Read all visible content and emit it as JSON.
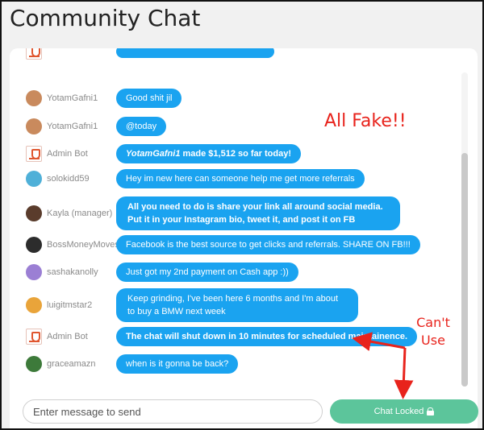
{
  "header": {
    "title": "Community Chat"
  },
  "colors": {
    "bubble": "#1aa3f0",
    "locked_button": "#5cc59b",
    "annotation": "#e8231c"
  },
  "messages": [
    {
      "user": "Admin Bot",
      "text": "YotamGafni1 made $1,512 so far today!",
      "avatar": "admin-bot-icon",
      "partial": true
    },
    {
      "user": "YotamGafni1",
      "text": "Good shit jil",
      "avatar": "user-avatar"
    },
    {
      "user": "YotamGafni1",
      "text": "@today",
      "avatar": "user-avatar"
    },
    {
      "user": "Admin Bot",
      "text_emph": "YotamGafni1",
      "text_rest": " made $1,512 so far today!",
      "avatar": "admin-bot-icon"
    },
    {
      "user": "solokidd59",
      "text": "Hey im new here can someone help me get more referrals",
      "avatar": "user-avatar"
    },
    {
      "user": "Kayla (manager)",
      "text": "All you need to do is share your link all around social media. Put it in your Instagram bio, tweet it, and post it on FB",
      "avatar": "user-avatar"
    },
    {
      "user": "BossMoneyMoves",
      "text": "Facebook is the best source to get clicks and referrals. SHARE ON FB!!!",
      "avatar": "user-avatar"
    },
    {
      "user": "sashakanolly",
      "text": "Just got my 2nd payment on Cash app :))",
      "avatar": "user-avatar"
    },
    {
      "user": "luigitmstar2",
      "text": "Keep grinding, I've been here 6 months and I'm about to buy a BMW next week",
      "avatar": "user-avatar"
    },
    {
      "user": "Admin Bot",
      "text": "The chat will shut down in 10 minutes for scheduled maintainence.",
      "avatar": "admin-bot-icon"
    },
    {
      "user": "graceamazn",
      "text": "when is it gonna be back?",
      "avatar": "user-avatar"
    }
  ],
  "composer": {
    "placeholder": "Enter message to send",
    "button_label": "Chat Locked",
    "button_icon": "lock-icon"
  },
  "annotations": {
    "fake": "All Fake!!",
    "cant_line1": "Can't",
    "cant_line2": "Use"
  }
}
